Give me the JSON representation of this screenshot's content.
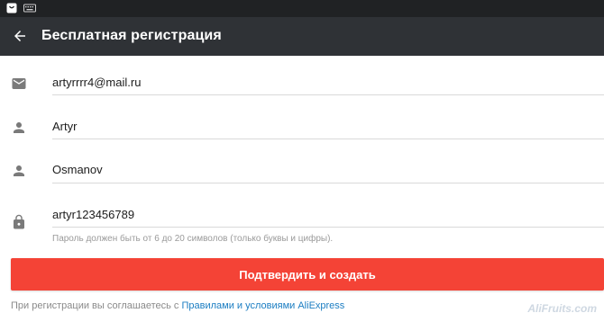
{
  "app": {
    "title": "Бесплатная регистрация"
  },
  "fields": [
    {
      "icon": "email-icon",
      "value": "artyrrrr4@mail.ru"
    },
    {
      "icon": "person-icon",
      "value": "Artyr"
    },
    {
      "icon": "person-icon",
      "value": "Osmanov"
    },
    {
      "icon": "lock-icon",
      "value": "artyr123456789"
    }
  ],
  "password_hint": "Пароль должен быть от 6 до 20 символов (только буквы и цифры).",
  "submit_label": "Подтвердить и создать",
  "terms": {
    "prefix": "При регистрации вы соглашаетесь с ",
    "link": "Правилами и условиями AliExpress"
  },
  "watermark": "AliFruits.com",
  "colors": {
    "toolbar": "#2f3236",
    "status_bar": "#202224",
    "accent": "#f44336",
    "link": "#1b7dc2"
  }
}
